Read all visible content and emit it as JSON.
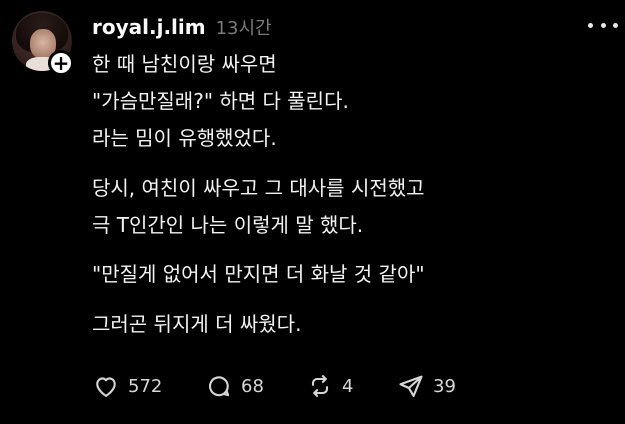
{
  "post": {
    "username": "royal.j.lim",
    "time": "13시간",
    "lines": [
      "한 때 남친이랑 싸우면",
      "\"가슴만질래?\" 하면 다 풀린다.",
      "라는 밈이 유행했었다.",
      "당시, 여친이 싸우고 그 대사를 시전했고",
      "극 T인간인 나는 이렇게 말 했다.",
      "\"만질게 없어서 만지면 더 화날 것 같아\"",
      "그러곤 뒤지게 더 싸웠다."
    ]
  },
  "actions": {
    "likes": "572",
    "comments": "68",
    "reposts": "4",
    "shares": "39"
  },
  "icons": {
    "avatar_badge": "plus-icon",
    "more": "more-options-icon",
    "like": "heart-icon",
    "comment": "comment-icon",
    "repost": "repost-icon",
    "share": "send-icon"
  }
}
